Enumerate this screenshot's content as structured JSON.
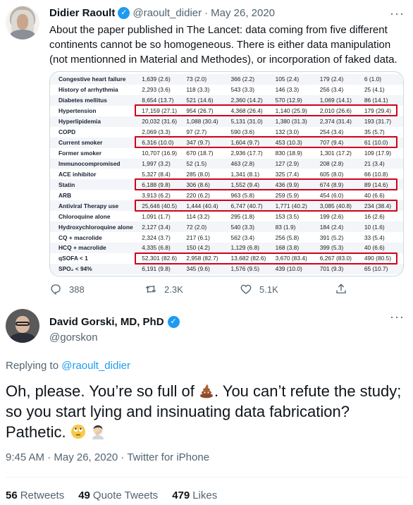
{
  "parent_tweet": {
    "author_name": "Didier Raoult",
    "handle": "@raoult_didier",
    "date": "May 26, 2020",
    "separator": "·",
    "more_icon": "more-horizontal-icon",
    "text": "About the paper published in The Lancet: data coming from five different continents cannot be so homogeneous. There is either data manipulation (not mentionned in Material and Methodes), or incorporation of faked data.",
    "table": {
      "rows": [
        {
          "label": "Congestive heart failure",
          "values": [
            "1,639 (2.6)",
            "73 (2.0)",
            "366 (2.2)",
            "105 (2.4)",
            "179 (2.4)",
            "6 (1.0)"
          ]
        },
        {
          "label": "History of arrhythmia",
          "values": [
            "2,293 (3.6)",
            "118 (3.3)",
            "543 (3.3)",
            "146 (3.3)",
            "256 (3.4)",
            "25 (4.1)"
          ]
        },
        {
          "label": "Diabetes mellitus",
          "values": [
            "8,654 (13.7)",
            "521 (14.6)",
            "2,360 (14.2)",
            "570 (12.9)",
            "1,069 (14.1)",
            "86 (14.1)"
          ]
        },
        {
          "label": "Hypertension",
          "values": [
            "17,159 (27.1)",
            "954 (26.7)",
            "4,368 (26.4)",
            "1,140 (25.9)",
            "2,010 (26.6)",
            "179 (29.4)"
          ]
        },
        {
          "label": "Hyperlipidemia",
          "values": [
            "20,032 (31.6)",
            "1,088 (30.4)",
            "5,131 (31.0)",
            "1,380 (31.3)",
            "2,374 (31.4)",
            "193 (31.7)"
          ]
        },
        {
          "label": "COPD",
          "values": [
            "2,069 (3.3)",
            "97 (2.7)",
            "590 (3.6)",
            "132 (3.0)",
            "254 (3.4)",
            "35 (5.7)"
          ]
        },
        {
          "label": "Current smoker",
          "values": [
            "6,316 (10.0)",
            "347 (9.7)",
            "1,604 (9.7)",
            "453 (10.3)",
            "707 (9.4)",
            "61 (10.0)"
          ]
        },
        {
          "label": "Former smoker",
          "values": [
            "10,707 (16.9)",
            "670 (18.7)",
            "2,936 (17.7)",
            "830 (18.9)",
            "1,301 (17.2)",
            "109 (17.9)"
          ]
        },
        {
          "label": "Immunocompromised",
          "values": [
            "1,997 (3.2)",
            "52 (1.5)",
            "463 (2.8)",
            "127 (2.9)",
            "208 (2.8)",
            "21 (3.4)"
          ]
        },
        {
          "label": "ACE inhibitor",
          "values": [
            "5,327 (8.4)",
            "285 (8.0)",
            "1,341 (8.1)",
            "325 (7.4)",
            "605 (8.0)",
            "66 (10.8)"
          ]
        },
        {
          "label": "Statin",
          "values": [
            "6,188 (9.8)",
            "306 (8.6)",
            "1,552 (9.4)",
            "436 (9.9)",
            "674 (8.9)",
            "89 (14.6)"
          ]
        },
        {
          "label": "ARB",
          "values": [
            "3,913 (6.2)",
            "220 (6.2)",
            "963 (5.8)",
            "259 (5.9)",
            "454 (6.0)",
            "40 (6.6)"
          ]
        },
        {
          "label": "Antiviral Therapy use",
          "values": [
            "25,646 (40.5)",
            "1,444 (40.4)",
            "6,747 (40.7)",
            "1,771 (40.2)",
            "3,085 (40.8)",
            "234 (38.4)"
          ]
        },
        {
          "label": "Chloroquine alone",
          "values": [
            "1,091 (1.7)",
            "114 (3.2)",
            "295 (1.8)",
            "153 (3.5)",
            "199 (2.6)",
            "16 (2.6)"
          ]
        },
        {
          "label": "Hydroxychloroquine alone",
          "values": [
            "2,127 (3.4)",
            "72 (2.0)",
            "540 (3.3)",
            "83 (1.9)",
            "184 (2.4)",
            "10 (1.6)"
          ]
        },
        {
          "label": "CQ + macrolide",
          "values": [
            "2,324 (3.7)",
            "217 (6.1)",
            "562 (3.4)",
            "256 (5.8)",
            "391 (5.2)",
            "33 (5.4)"
          ]
        },
        {
          "label": "HCQ + macrolide",
          "values": [
            "4,335 (6.8)",
            "150 (4.2)",
            "1,129 (6.8)",
            "168 (3.8)",
            "399 (5.3)",
            "40 (6.6)"
          ]
        },
        {
          "label": "qSOFA < 1",
          "values": [
            "52,301 (82.6)",
            "2,958 (82.7)",
            "13,682 (82.6)",
            "3,670 (83.4)",
            "6,267 (83.0)",
            "490 (80.5)"
          ]
        },
        {
          "label": "SPO₂ < 94%",
          "values": [
            "6,191 (9.8)",
            "345 (9.6)",
            "1,576 (9.5)",
            "439 (10.0)",
            "701 (9.3)",
            "65 (10.7)"
          ]
        }
      ],
      "highlighted_rows": [
        "Hypertension",
        "Current smoker",
        "Statin",
        "Antiviral Therapy use",
        "qSOFA < 1"
      ],
      "highlight_color": "#d0021b"
    },
    "actions": {
      "reply_icon": "reply-icon",
      "reply_count": "388",
      "retweet_icon": "retweet-icon",
      "retweet_count": "2.3K",
      "like_icon": "like-icon",
      "like_count": "5.1K",
      "share_icon": "share-icon"
    }
  },
  "reply_tweet": {
    "author_name": "David Gorski, MD, PhD",
    "handle": "@gorskon",
    "more_icon": "more-horizontal-icon",
    "replying_prefix": "Replying to",
    "replying_to": "@raoult_didier",
    "text_part1": "Oh, please. You’re so full of ",
    "emoji1": "pile-of-poo-emoji",
    "text_part2": ". You can’t refute the study; so you start lying and insinuating data fabrication? Pathetic. ",
    "emoji2": "face-with-rolling-eyes-emoji",
    "emoji3": "man-facepalming-emoji",
    "meta": "9:45 AM · May 26, 2020 · Twitter for iPhone",
    "stats": {
      "retweets_count": "56",
      "retweets_label": "Retweets",
      "quote_count": "49",
      "quote_label": "Quote Tweets",
      "likes_count": "479",
      "likes_label": "Likes"
    }
  },
  "colors": {
    "accent": "#1d9bf0",
    "secondary_text": "#536471",
    "primary_text": "#0f1419",
    "border": "#cfd9de"
  }
}
